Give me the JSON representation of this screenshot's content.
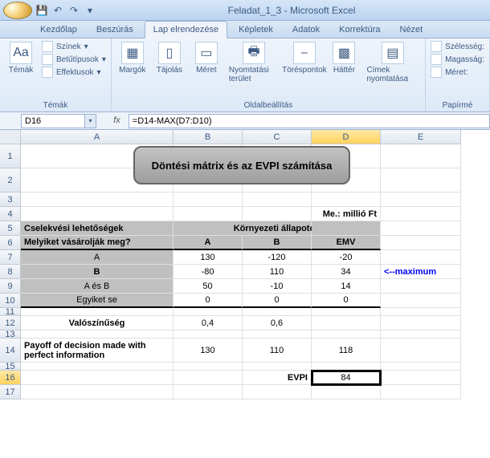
{
  "title": "Feladat_1_3 - Microsoft Excel",
  "tabs": [
    "Kezdőlap",
    "Beszúrás",
    "Lap elrendezése",
    "Képletek",
    "Adatok",
    "Korrektúra",
    "Nézet"
  ],
  "active_tab": 2,
  "ribbon": {
    "group1": {
      "label": "Témák",
      "themes": "Témák",
      "colors": "Színek",
      "fonts": "Betűtípusok",
      "effects": "Effektusok"
    },
    "group2": {
      "label": "Oldalbeállítás",
      "margins": "Margók",
      "orient": "Tájolás",
      "size": "Méret",
      "printarea": "Nyomtatási terület",
      "breaks": "Töréspontok",
      "bg": "Háttér",
      "titles": "Címek nyomtatása"
    },
    "group3": {
      "width": "Szélesség:",
      "height": "Magasság:",
      "scale": "Méret:",
      "label": "Papírmé"
    }
  },
  "namebox": "D16",
  "formula": "=D14-MAX(D7:D10)",
  "cols": [
    "A",
    "B",
    "C",
    "D",
    "E"
  ],
  "rows": [
    "1",
    "2",
    "3",
    "4",
    "5",
    "6",
    "7",
    "8",
    "9",
    "10",
    "11",
    "12",
    "13",
    "14",
    "15",
    "16",
    "17"
  ],
  "sheet": {
    "shape": "Döntési mátrix és az EVPI számítása",
    "me": "Me.: millió Ft",
    "h5a": "Cselekvési lehetőségek",
    "h5bc": "Környezeti állapotok",
    "h6a": "Melyiket vásárolják meg?",
    "h6b": "A",
    "h6c": "B",
    "h6d": "EMV",
    "r7": {
      "a": "A",
      "b": "130",
      "c": "-120",
      "d": "-20"
    },
    "r8": {
      "a": "B",
      "b": "-80",
      "c": "110",
      "d": "34"
    },
    "r8e": "<--maximum",
    "r9": {
      "a": "A és B",
      "b": "50",
      "c": "-10",
      "d": "14"
    },
    "r10": {
      "a": "Egyiket se",
      "b": "0",
      "c": "0",
      "d": "0"
    },
    "r12": {
      "a": "Valószínűség",
      "b": "0,4",
      "c": "0,6"
    },
    "r14": {
      "a": "Payoff of decision made with perfect information",
      "b": "130",
      "c": "110",
      "d": "118"
    },
    "r16": {
      "c": "EVPI",
      "d": "84"
    }
  }
}
